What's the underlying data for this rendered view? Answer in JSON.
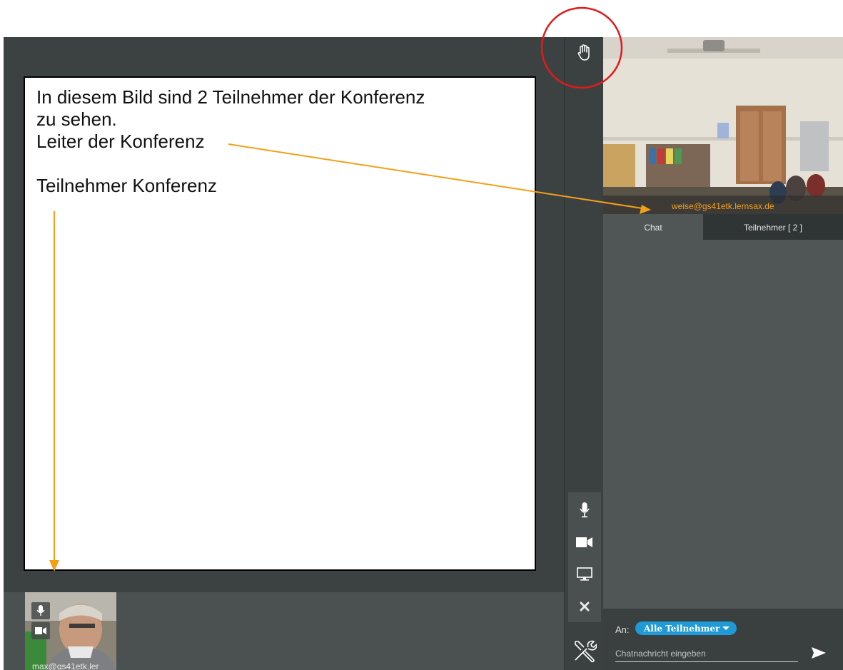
{
  "annotation": {
    "line1": "In diesem Bild sind 2 Teilnehmer der Konferenz",
    "line2": "zu sehen.",
    "line3": "Leiter der Konferenz",
    "line4": "Teilnehmer Konferenz"
  },
  "remote_video": {
    "name": "weise@gs41etk.lernsax.de"
  },
  "tabs": {
    "chat": "Chat",
    "participants": "Teilnehmer [ 2 ]"
  },
  "local_video": {
    "name": "max@gs41etk.ler"
  },
  "chat": {
    "to_label": "An:",
    "recipient": "Alle Teilnehmer",
    "placeholder": "Chatnachricht eingeben"
  },
  "colors": {
    "accent_orange": "#f2a019",
    "highlight_circle": "#e11b1b",
    "recipient_badge": "#1f9ad6"
  },
  "icons": [
    "raise-hand-icon",
    "microphone-icon",
    "camera-icon",
    "screen-share-icon",
    "close-icon",
    "tools-icon",
    "send-icon"
  ]
}
